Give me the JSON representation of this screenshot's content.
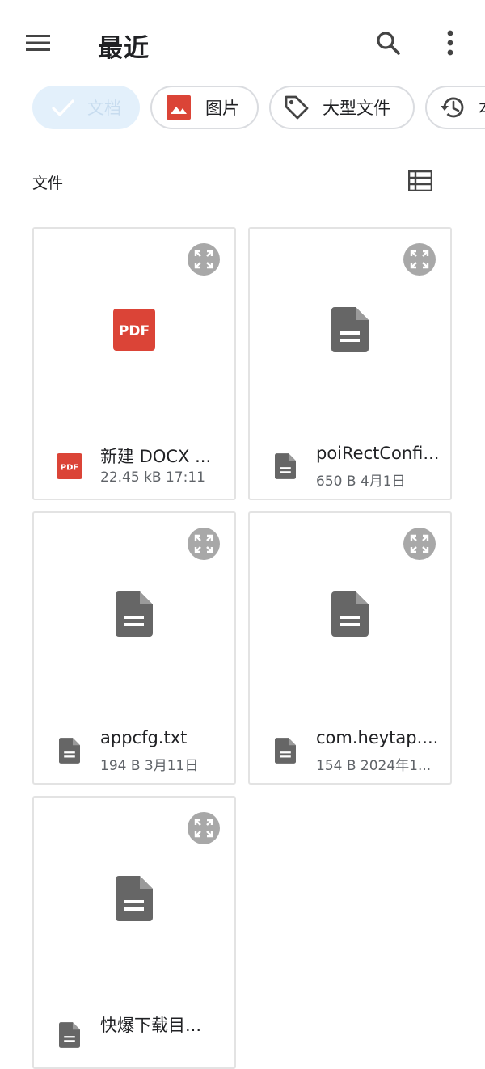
{
  "appbar": {
    "title": "最近",
    "menu_icon": "menu-icon",
    "search_icon": "search-icon",
    "more_icon": "more-vert-icon"
  },
  "chips": [
    {
      "label": "文档",
      "icon": "check-icon",
      "selected": true
    },
    {
      "label": "图片",
      "icon": "image-icon",
      "selected": false
    },
    {
      "label": "大型文件",
      "icon": "tag-icon",
      "selected": false
    },
    {
      "label": "本",
      "icon": "history-icon",
      "selected": false
    }
  ],
  "section": {
    "title": "文件",
    "view_icon": "list-view-icon"
  },
  "files": [
    {
      "name": "新建 DOCX ...",
      "info": "22.45 kB 17:11",
      "type": "pdf"
    },
    {
      "name": "poiRectConfi...",
      "info": "650 B 4月1日",
      "type": "doc"
    },
    {
      "name": "appcfg.txt",
      "info": "194 B 3月11日",
      "type": "doc"
    },
    {
      "name": "com.heytap....",
      "info": "154 B 2024年1...",
      "type": "doc"
    },
    {
      "name": "快爆下载目...",
      "info": "",
      "type": "doc"
    }
  ],
  "colors": {
    "pdf_red": "#db4437",
    "doc_gray": "#666666",
    "chip_selected_bg": "#e3f0fb",
    "expand_bg": "#a8a8a8"
  }
}
